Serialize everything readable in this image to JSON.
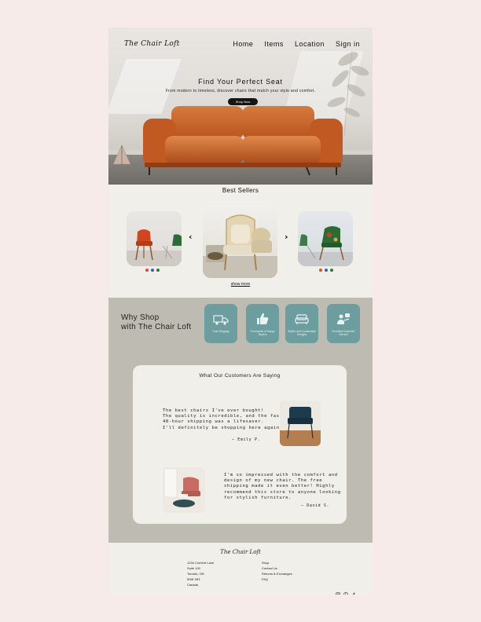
{
  "brand": "The Chair Loft",
  "nav": [
    "Home",
    "Items",
    "Location",
    "Sign in"
  ],
  "hero": {
    "title": "Find Your Perfect Seat",
    "subtitle": "From modern to timeless, discover chairs that match your style and comfort.",
    "button": "Shop Now"
  },
  "best_sellers": {
    "title": "Best Sellers",
    "show_more": "show more",
    "dots_left": [
      "#d94f2b",
      "#3a5fb8",
      "#2f7a3c"
    ],
    "dots_right": [
      "#d94f2b",
      "#3a5fb8",
      "#2f7a3c"
    ]
  },
  "why": {
    "title_line1": "Why Shop",
    "title_line2": "with The Chair Loft",
    "features": [
      {
        "label": "Fast Shipping",
        "icon": "truck-icon"
      },
      {
        "label": "Thousands of Happy Buyers",
        "icon": "thumbs-up-icon"
      },
      {
        "label": "Stylish and Comfortable Designs",
        "icon": "sofa-icon"
      },
      {
        "label": "Excellent Customer Service",
        "icon": "customer-service-icon"
      }
    ]
  },
  "reviews": {
    "title": "What Our Customers Are Saying",
    "items": [
      {
        "lines": [
          "The best chairs I've ever bought!",
          "The quality is incredible, and the fast",
          "48-hour shipping was a lifesaver.",
          "I'll definitely be shopping here again!"
        ],
        "author": "— Emily P."
      },
      {
        "lines": [
          "I'm so impressed with the comfort and",
          "design of my new chair. The free",
          "shipping made it even better! Highly",
          "recommend this store to anyone looking",
          "for stylish furniture."
        ],
        "author": "— David S."
      }
    ]
  },
  "footer": {
    "brand": "The Chair Loft",
    "address": [
      "1234 Comfort Lane",
      "Suite 100",
      "Toronto, ON",
      "M4B 1B3",
      "Canada"
    ],
    "links": [
      "Shop",
      "Contact Us",
      "Returns & Exchanges",
      "FAQ"
    ],
    "social": [
      "instagram-icon",
      "pinterest-icon",
      "facebook-icon"
    ]
  },
  "colors": {
    "accent": "#6c9ea0",
    "sofa": "#c8622b",
    "section_bg": "#bdbbb2",
    "page_bg": "#f6ebe8"
  }
}
